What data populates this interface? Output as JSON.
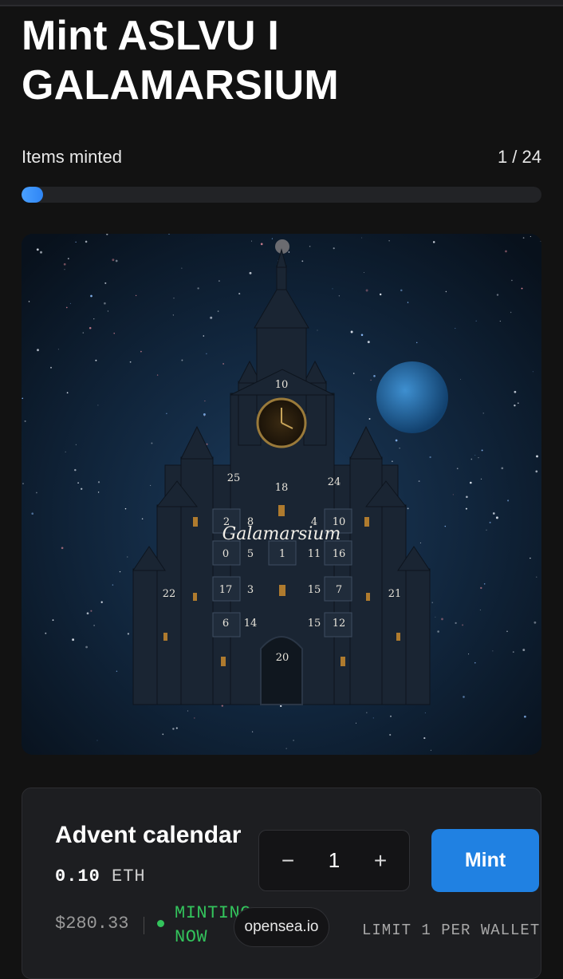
{
  "page": {
    "title": "Mint ASLVU I GALAMARSIUM"
  },
  "progress": {
    "label": "Items minted",
    "count_text": "1 / 24",
    "minted": 1,
    "total": 24
  },
  "artwork": {
    "title_text": "Galamarsium",
    "numbers": [
      "10",
      "25",
      "18",
      "24",
      "2",
      "8",
      "4",
      "10",
      "0",
      "5",
      "1",
      "11",
      "16",
      "22",
      "17",
      "3",
      "15",
      "7",
      "21",
      "6",
      "14",
      "15",
      "12",
      "20"
    ]
  },
  "mint_card": {
    "product_name": "Advent calendar",
    "price_value": "0.10",
    "price_currency": "ETH",
    "price_usd": "$280.33",
    "status": "MINTING NOW",
    "quantity": "1",
    "decrement_symbol": "−",
    "increment_symbol": "+",
    "mint_label": "Mint",
    "limit_text": "LIMIT 1 PER WALLET"
  },
  "footer": {
    "domain_pill": "opensea.io"
  },
  "colors": {
    "accent": "#2081e2",
    "progress_fill": "#3b8ef3",
    "status_green": "#33c35c",
    "background": "#121212"
  },
  "icons": [
    "minus-icon",
    "plus-icon",
    "status-dot-icon"
  ]
}
